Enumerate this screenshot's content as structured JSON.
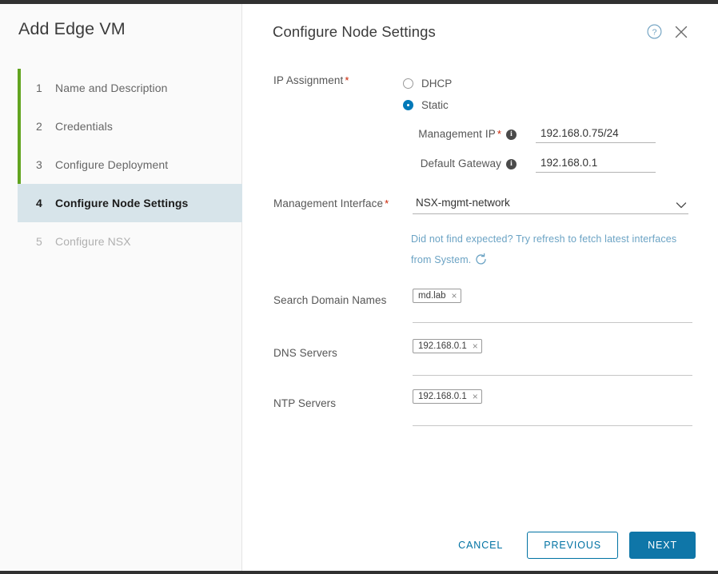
{
  "window": {
    "accent_blue": "#0072a3",
    "progress_green": "#62a420",
    "active_step_bg": "#d7e4ea",
    "required_red": "#c92100",
    "hint_blue": "#6ba3c4"
  },
  "sidebar": {
    "title": "Add Edge VM",
    "steps": [
      {
        "num": "1",
        "label": "Name and Description",
        "state": "completed"
      },
      {
        "num": "2",
        "label": "Credentials",
        "state": "completed"
      },
      {
        "num": "3",
        "label": "Configure Deployment",
        "state": "completed"
      },
      {
        "num": "4",
        "label": "Configure Node Settings",
        "state": "active"
      },
      {
        "num": "5",
        "label": "Configure NSX",
        "state": "disabled"
      }
    ]
  },
  "panel": {
    "title": "Configure Node Settings",
    "help_icon": "help-circle-icon",
    "close_icon": "close-icon"
  },
  "form": {
    "ip_assignment": {
      "label": "IP Assignment",
      "required": true,
      "options": [
        {
          "label": "DHCP",
          "checked": false
        },
        {
          "label": "Static",
          "checked": true
        }
      ]
    },
    "management_ip": {
      "label": "Management IP",
      "required": true,
      "info_icon": "info-icon",
      "value": "192.168.0.75/24",
      "placeholder": ""
    },
    "default_gateway": {
      "label": "Default Gateway",
      "required": false,
      "info_icon": "info-icon",
      "value": "192.168.0.1",
      "placeholder": ""
    },
    "management_interface": {
      "label": "Management Interface",
      "required": true,
      "value": "NSX-mgmt-network",
      "chevron_icon": "chevron-down-icon"
    },
    "refresh_hint": {
      "text": "Did not find expected? Try refresh to fetch latest interfaces from System.",
      "icon": "refresh-icon"
    },
    "search_domain_names": {
      "label": "Search Domain Names",
      "tokens": [
        "md.lab"
      ]
    },
    "dns_servers": {
      "label": "DNS Servers",
      "tokens": [
        "192.168.0.1"
      ]
    },
    "ntp_servers": {
      "label": "NTP Servers",
      "tokens": [
        "192.168.0.1"
      ]
    },
    "token_remove_glyph": "×"
  },
  "footer": {
    "cancel": "CANCEL",
    "previous": "PREVIOUS",
    "next": "NEXT"
  }
}
